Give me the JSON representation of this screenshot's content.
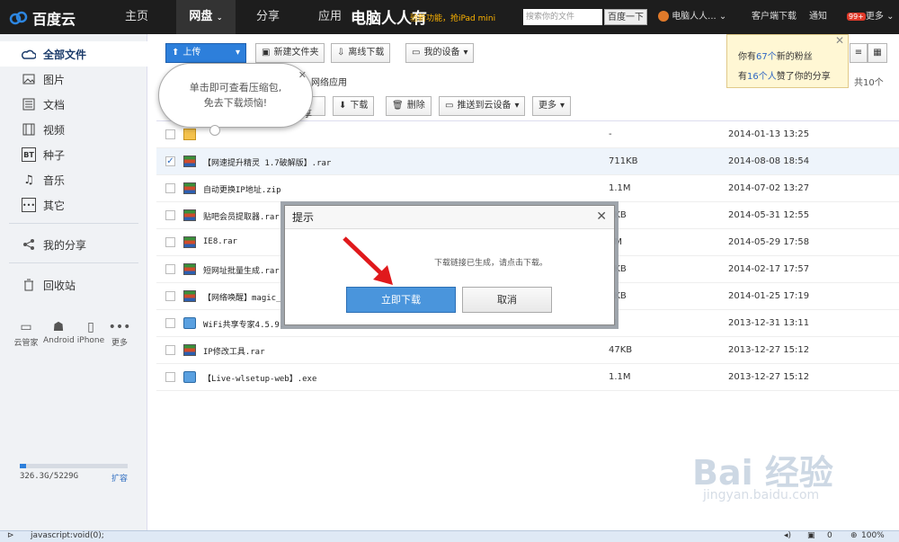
{
  "topbar": {
    "logo": "百度云",
    "nav": [
      "主页",
      "网盘",
      "分享",
      "应用"
    ],
    "promo": "电脑人人有",
    "promo_sub": "验新功能，抢iPad mini",
    "search_placeholder": "搜索你的文件",
    "search_button": "百度一下",
    "user": "电脑人人...",
    "client_download": "客户端下载",
    "notice": "通知",
    "badge": "99+",
    "more": "更多"
  },
  "sidebar": {
    "items": [
      {
        "label": "全部文件",
        "icon": "cloud-icon"
      },
      {
        "label": "图片",
        "icon": "picture-icon"
      },
      {
        "label": "文档",
        "icon": "document-icon"
      },
      {
        "label": "视频",
        "icon": "video-icon"
      },
      {
        "label": "种子",
        "icon": "bt-icon"
      },
      {
        "label": "音乐",
        "icon": "music-icon"
      },
      {
        "label": "其它",
        "icon": "other-icon"
      }
    ],
    "share": "我的分享",
    "trash": "回收站",
    "devices": [
      "云管家",
      "Android",
      "iPhone",
      "更多"
    ],
    "quota": "326.3G/5229G",
    "quota_fraction": 0.06,
    "expand": "扩容"
  },
  "toolbar": {
    "upload": "上传",
    "new_folder": "新建文件夹",
    "offline": "离线下载",
    "devices": "我的设备",
    "share": "分享",
    "download": "下载",
    "delete": "删除",
    "push": "推送到云设备",
    "more": "更多"
  },
  "breadcrumb": "网络应用",
  "count_text": "载，共10个",
  "files": [
    {
      "name": "",
      "size": "-",
      "date": "2014-01-13 13:25",
      "type": "folder",
      "checked": false
    },
    {
      "name": "【网速提升精灵 1.7破解版】.rar",
      "size": "711KB",
      "date": "2014-08-08 18:54",
      "type": "rar",
      "checked": true
    },
    {
      "name": "自动更换IP地址.zip",
      "size": "1.1M",
      "date": "2014-07-02 13:27",
      "type": "rar",
      "checked": false
    },
    {
      "name": "贴吧会员提取器.rar",
      "size": "5KB",
      "date": "2014-05-31 12:55",
      "type": "rar",
      "checked": false
    },
    {
      "name": "IE8.rar",
      "size": "1M",
      "date": "2014-05-29 17:58",
      "type": "rar",
      "checked": false
    },
    {
      "name": "短网址批量生成.rar",
      "size": "3KB",
      "date": "2014-02-17 17:57",
      "type": "rar",
      "checked": false
    },
    {
      "name": "【网络唤醒】magic_",
      "size": "5KB",
      "date": "2014-01-25 17:19",
      "type": "rar",
      "checked": false
    },
    {
      "name": "WiFi共享专家4.5.9.",
      "size": "M",
      "date": "2013-12-31 13:11",
      "type": "exe",
      "checked": false
    },
    {
      "name": "IP修改工具.rar",
      "size": "47KB",
      "date": "2013-12-27 15:12",
      "type": "rar",
      "checked": false
    },
    {
      "name": "【Live-wlsetup-web】.exe",
      "size": "1.1M",
      "date": "2013-12-27 15:12",
      "type": "exe",
      "checked": false
    }
  ],
  "notification": {
    "line1_pre": "你有",
    "line1_num": "67个",
    "line1_post": "新的粉丝",
    "line2_pre": "有",
    "line2_num": "16个人",
    "line2_post": "赞了你的分享"
  },
  "tooltip": {
    "line1": "单击即可查看压缩包,",
    "line2": "免去下载烦恼!"
  },
  "dialog": {
    "title": "提示",
    "message": "下载链接已生成，请点击下载。",
    "ok": "立即下载",
    "cancel": "取消"
  },
  "status": {
    "url": "javascript:void(0);",
    "count": "0",
    "zoom": "100%"
  },
  "watermark": {
    "text": "Bai 经验",
    "url": "jingyan.baidu.com"
  }
}
